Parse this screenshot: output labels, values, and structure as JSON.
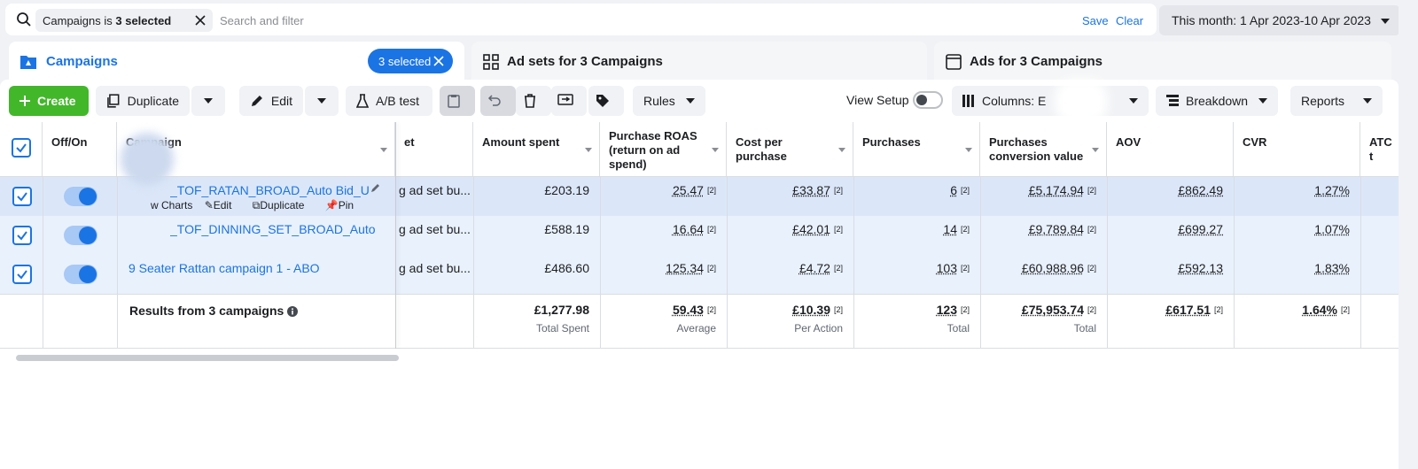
{
  "filter_bar": {
    "chip_prefix": "Campaigns is ",
    "chip_bold": "3 selected",
    "placeholder": "Search and filter",
    "save": "Save",
    "clear": "Clear",
    "date_range": "This month: 1 Apr 2023-10 Apr 2023"
  },
  "tabs": {
    "campaigns": "Campaigns",
    "selected_pill": "3 selected",
    "adsets": "Ad sets for 3 Campaigns",
    "ads": "Ads for 3 Campaigns"
  },
  "toolbar": {
    "create": "Create",
    "duplicate": "Duplicate",
    "edit": "Edit",
    "ab_test": "A/B test",
    "rules": "Rules",
    "view_setup": "View Setup",
    "columns": "Columns: E",
    "breakdown": "Breakdown",
    "reports": "Reports"
  },
  "columns": {
    "offon": "Off/On",
    "campaign": "Campaign",
    "bid": "et",
    "amount": "Amount spent",
    "roas": "Purchase ROAS (return on ad spend)",
    "cpp": "Cost per purchase",
    "purchases": "Purchases",
    "pcv": "Purchases conversion value",
    "aov": "AOV",
    "cvr": "CVR",
    "atc": "ATC t"
  },
  "rows": [
    {
      "name": "_TOF_RATAN_BROAD_Auto Bid_UK_...",
      "bid": "g ad set bu...",
      "amount": "£203.19",
      "roas": "25.47",
      "cpp": "£33.87",
      "purchases": "6",
      "pcv": "£5,174.94",
      "aov": "£862.49",
      "cvr": "1.27%",
      "actions": {
        "charts": "w Charts",
        "edit": "Edit",
        "duplicate": "Duplicate",
        "pin": "Pin"
      }
    },
    {
      "name": "_TOF_DINNING_SET_BROAD_Auto Bid...",
      "bid": "g ad set bu...",
      "amount": "£588.19",
      "roas": "16.64",
      "cpp": "£42.01",
      "purchases": "14",
      "pcv": "£9,789.84",
      "aov": "£699.27",
      "cvr": "1.07%"
    },
    {
      "name": "9 Seater Rattan campaign 1 - ABO",
      "bid": "g ad set bu...",
      "amount": "£486.60",
      "roas": "125.34",
      "cpp": "£4.72",
      "purchases": "103",
      "pcv": "£60,988.96",
      "aov": "£592.13",
      "cvr": "1.83%"
    }
  ],
  "footnote_mark": "[2]",
  "totals": {
    "label": "Results from 3 campaigns",
    "amount": "£1,277.98",
    "amount_sub": "Total Spent",
    "roas": "59.43",
    "roas_sub": "Average",
    "cpp": "£10.39",
    "cpp_sub": "Per Action",
    "purchases": "123",
    "purchases_sub": "Total",
    "pcv": "£75,953.74",
    "pcv_sub": "Total",
    "aov": "£617.51",
    "cvr": "1.64%"
  },
  "colors": {
    "accent": "#1b74e4",
    "create": "#42b72a",
    "row_selected": "#dbe7f9"
  }
}
